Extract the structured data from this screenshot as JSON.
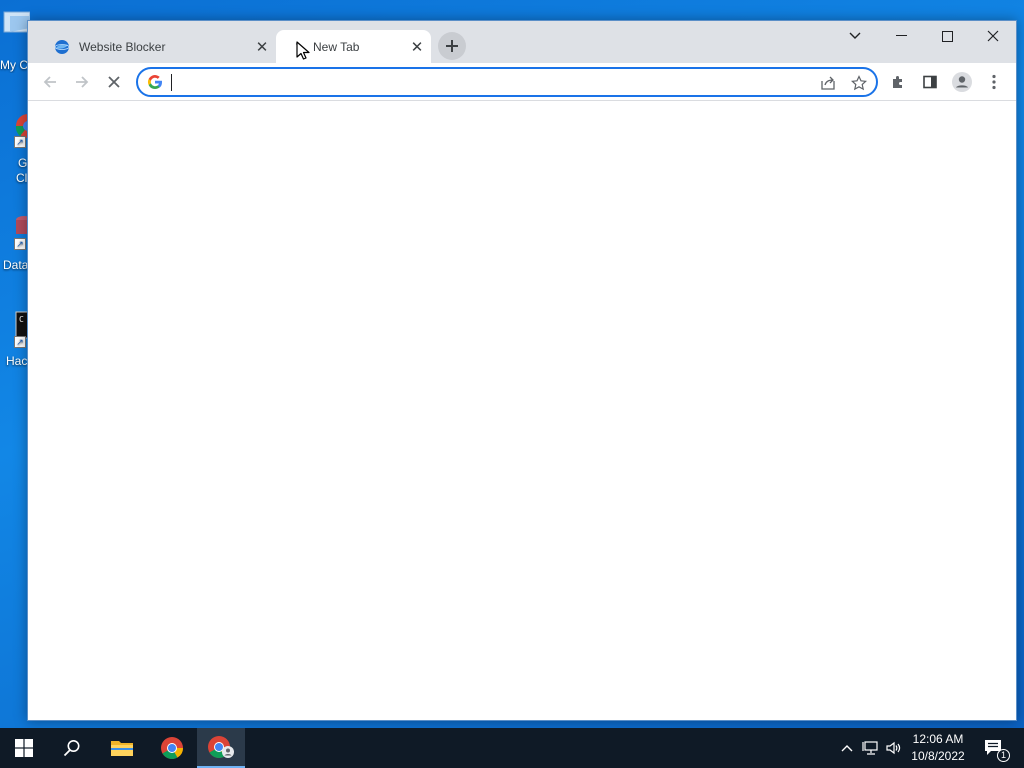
{
  "desktop": {
    "icons": [
      {
        "label": "My C"
      },
      {
        "label": "G",
        "label2": "Cl"
      },
      {
        "label": "Data"
      },
      {
        "label": "Hac"
      }
    ]
  },
  "browser": {
    "tabs": [
      {
        "title": "Website Blocker",
        "favicon": "globe-icon",
        "active": false
      },
      {
        "title": "New Tab",
        "favicon": "loading-icon",
        "active": true
      }
    ],
    "omnibox": {
      "value": "",
      "placeholder": ""
    },
    "colors": {
      "accent": "#1a73e8",
      "tabstrip": "#dee1e6"
    }
  },
  "taskbar": {
    "time": "12:06 AM",
    "date": "10/8/2022",
    "notification_count": "1"
  }
}
